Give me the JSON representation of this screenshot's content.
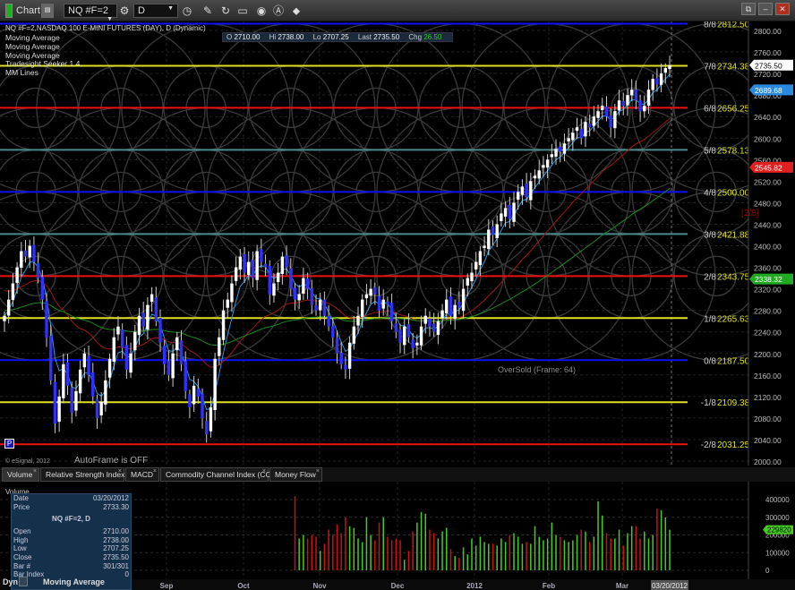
{
  "window": {
    "title": "Chart",
    "symbol": "NQ #F=2",
    "interval": "D"
  },
  "legend": {
    "title": "NQ #F=2,NASDAQ 100 E-MINI FUTURES (DAY), D (Dynamic)",
    "studies": [
      "Moving Average",
      "Moving Average",
      "Moving Average",
      "Tradesight Seeker 1.4",
      "MM Lines"
    ]
  },
  "ohlc": {
    "o_label": "O",
    "o": "2710.00",
    "h_label": "Hi",
    "h": "2738.00",
    "l_label": "Lo",
    "l": "2707.25",
    "last_label": "Last",
    "last": "2735.50",
    "chg_label": "Chg",
    "chg": "26.50"
  },
  "annotations": {
    "autoframe": "AutoFrame is OFF",
    "oversold": "OverSold (Frame: 64)",
    "copyright": "© eSignal, 2012",
    "p_marker": "P",
    "extra_tag": "[2/8]"
  },
  "colors": {
    "up": "#ffffff",
    "down": "#3030ff",
    "vol_up": "#44cc22",
    "vol_down": "#cc1111"
  },
  "chart_data": [
    {
      "type": "candlestick",
      "ylim": [
        2000,
        2800
      ],
      "yticks": [
        "2800.00",
        "2760.00",
        "2720.00",
        "2680.00",
        "2640.00",
        "2600.00",
        "2560.00",
        "2520.00",
        "2480.00",
        "2440.00",
        "2400.00",
        "2360.00",
        "2320.00",
        "2280.00",
        "2240.00",
        "2200.00",
        "2160.00",
        "2120.00",
        "2080.00",
        "2040.00",
        "2000.00"
      ],
      "xlabels": [
        "Sep",
        "Oct",
        "Nov",
        "Dec",
        "2012",
        "Feb",
        "Mar"
      ],
      "current_date": "03/20/2012",
      "closes": [
        2270,
        2300,
        2330,
        2360,
        2390,
        2380,
        2400,
        2370,
        2340,
        2300,
        2230,
        2150,
        2070,
        2120,
        2180,
        2140,
        2090,
        2130,
        2170,
        2200,
        2160,
        2120,
        2080,
        2110,
        2150,
        2190,
        2230,
        2250,
        2210,
        2170,
        2200,
        2240,
        2270,
        2250,
        2290,
        2310,
        2260,
        2220,
        2180,
        2160,
        2200,
        2230,
        2180,
        2130,
        2100,
        2140,
        2120,
        2080,
        2050,
        2100,
        2190,
        2230,
        2280,
        2300,
        2330,
        2360,
        2380,
        2350,
        2370,
        2340,
        2390,
        2370,
        2360,
        2310,
        2330,
        2350,
        2380,
        2360,
        2320,
        2300,
        2310,
        2340,
        2320,
        2290,
        2280,
        2300,
        2270,
        2250,
        2230,
        2200,
        2180,
        2170,
        2220,
        2250,
        2270,
        2300,
        2310,
        2320,
        2310,
        2280,
        2300,
        2290,
        2260,
        2240,
        2220,
        2250,
        2230,
        2210,
        2220,
        2250,
        2270,
        2250,
        2240,
        2260,
        2280,
        2300,
        2270,
        2290,
        2285,
        2320,
        2340,
        2350,
        2370,
        2390,
        2400,
        2430,
        2420,
        2440,
        2460,
        2470,
        2450,
        2480,
        2500,
        2510,
        2490,
        2520,
        2530,
        2540,
        2550,
        2560,
        2570,
        2580,
        2575,
        2590,
        2600,
        2610,
        2620,
        2600,
        2630,
        2620,
        2640,
        2650,
        2660,
        2640,
        2620,
        2650,
        2670,
        2660,
        2680,
        2690,
        2670,
        2650,
        2660,
        2690,
        2710,
        2700,
        2720,
        2730,
        2735.5
      ],
      "mm_lines": [
        {
          "label": "8/8",
          "value": "2812.50",
          "color": "#1010ff"
        },
        {
          "label": "7/8",
          "value": "2734.38",
          "color": "#e0e020"
        },
        {
          "label": "6/8",
          "value": "2656.25",
          "color": "#ee1111"
        },
        {
          "label": "5/8",
          "value": "2578.13",
          "color": "#4a8a8a"
        },
        {
          "label": "4/8",
          "value": "2500.00",
          "color": "#1010ff"
        },
        {
          "label": "3/8",
          "value": "2421.88",
          "color": "#4a8a8a"
        },
        {
          "label": "2/8",
          "value": "2343.75",
          "color": "#ee1111"
        },
        {
          "label": "1/8",
          "value": "2265.63",
          "color": "#e0e020"
        },
        {
          "label": "0/8",
          "value": "2187.50",
          "color": "#1010ff"
        },
        {
          "label": "-1/8",
          "value": "2109.38",
          "color": "#e0e020"
        },
        {
          "label": "-2/8",
          "value": "2031.25",
          "color": "#ee1111"
        }
      ],
      "badges": [
        {
          "value": "2735.50",
          "color": "#ffffff",
          "text": "#000"
        },
        {
          "value": "2689.68",
          "color": "#2a8ae0",
          "text": "#fff"
        },
        {
          "value": "2545.82",
          "color": "#e02020",
          "text": "#fff"
        },
        {
          "value": "2338.32",
          "color": "#22aa22",
          "text": "#fff"
        }
      ]
    },
    {
      "type": "bar",
      "title": "Volume",
      "ylim": [
        0,
        450000
      ],
      "yticks": [
        "400000",
        "300000",
        "200000",
        "100000",
        "0"
      ],
      "last_badge": "229820",
      "volumes": [
        420,
        180,
        200,
        180,
        200,
        190,
        110,
        150,
        230,
        200,
        260,
        210,
        300,
        250,
        240,
        180,
        160,
        300,
        200,
        170,
        270,
        300,
        190,
        170,
        180,
        170,
        60,
        110,
        220,
        270,
        330,
        320,
        230,
        210,
        180,
        220,
        240,
        120,
        80,
        70,
        130,
        90,
        180,
        140,
        190,
        160,
        150,
        150,
        140,
        180,
        160,
        200,
        210,
        190,
        150,
        160,
        150,
        250,
        190,
        170,
        180,
        270,
        200,
        190,
        170,
        160,
        170,
        200,
        230,
        220,
        160,
        190,
        390,
        310,
        210,
        180,
        180,
        230,
        140,
        210,
        250,
        250,
        180,
        220,
        180,
        200,
        350,
        340,
        300,
        229.82
      ]
    }
  ],
  "tabs": [
    "Volume",
    "Relative Strength Index",
    "MACD",
    "Commodity Channel Index (CCI)",
    "Money Flow"
  ],
  "data_window": {
    "rows": [
      [
        "Date",
        "03/20/2012"
      ],
      [
        "Price",
        "2733.30"
      ],
      [
        "",
        "NQ #F=2, D"
      ],
      [
        "Open",
        "2710.00"
      ],
      [
        "High",
        "2738.00"
      ],
      [
        "Low",
        "2707.25"
      ],
      [
        "Close",
        "2735.50"
      ],
      [
        "Bar #",
        "301/301"
      ],
      [
        "Bar Index",
        "0"
      ]
    ]
  },
  "footer": {
    "dyn": "Dyn",
    "study": "Moving Average"
  }
}
